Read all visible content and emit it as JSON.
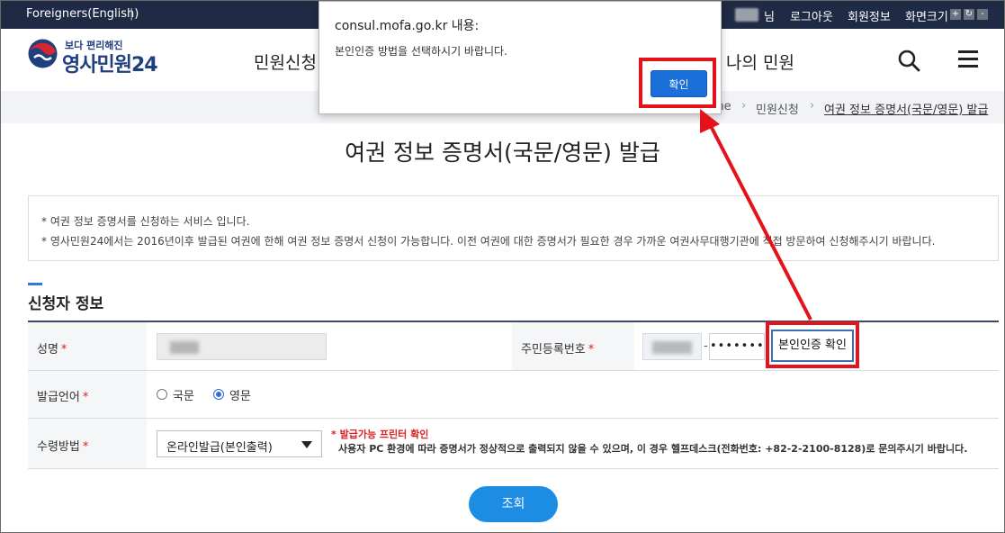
{
  "topbar": {
    "language_link": "Foreigners(English)",
    "separator": "|",
    "user_suffix": "님",
    "logout": "로그아웃",
    "member_info": "회원정보",
    "screen_size": "화면크기",
    "zoom_in": "+",
    "reset": "↻",
    "zoom_out": "-"
  },
  "header": {
    "logo_tagline": "보다 편리해진",
    "logo_name": "영사민원24",
    "nav": {
      "apply": "민원신청",
      "my_civil": "나의 민원"
    }
  },
  "breadcrumb": {
    "home": "me",
    "section": "민원신청",
    "current": "여권 정보 증명서(국문/영문) 발급"
  },
  "page": {
    "title": "여권 정보 증명서(국문/영문) 발급"
  },
  "notice": {
    "line1": "* 여권 정보 증명서를 신청하는 서비스 입니다.",
    "line2": "* 영사민원24에서는 2016년이후 발급된 여권에 한해 여권 정보 증명서 신청이 가능합니다. 이전 여권에 대한 증명서가 필요한 경우 가까운 여권사무대행기관에 직접 방문하여 신청해주시기 바랍니다."
  },
  "section": {
    "title": "신청자 정보"
  },
  "form": {
    "name_label": "성명",
    "rrn_label": "주민등록번호",
    "rrn_dash": "-",
    "rrn_back_masked": "•••••••",
    "cert_button": "본인인증 확인",
    "language_label": "발급언어",
    "lang_korean": "국문",
    "lang_english": "영문",
    "receive_label": "수령방법",
    "receive_selected": "온라인발급(본인출력)",
    "required_mark": "*",
    "help_title": "* 발급가능 프린터 확인",
    "help_text": "사용자 PC 환경에 따라 증명서가 정상적으로 출력되지 않을 수 있으며, 이 경우 헬프데스크(전화번호: +82-2-2100-8128)로 문의주시기 바랍니다.",
    "search_button": "조회"
  },
  "dialog": {
    "title": "consul.mofa.go.kr 내용:",
    "message": "본인인증 방법을 선택하시기 바랍니다.",
    "ok": "확인"
  },
  "colors": {
    "topbar": "#1f2a44",
    "brand": "#1f3f7e",
    "accent": "#1d8ce3",
    "annotation": "#e4121b"
  }
}
